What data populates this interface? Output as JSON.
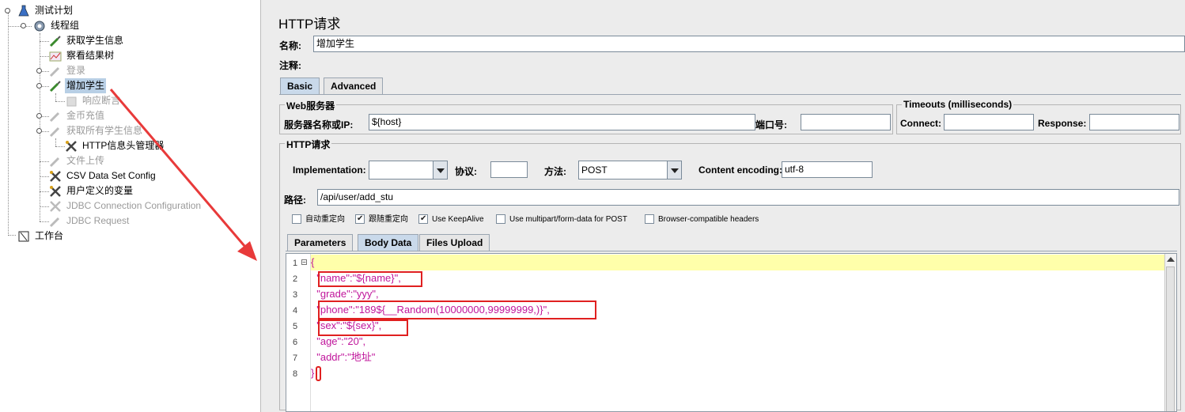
{
  "tree": {
    "root": "测试计划",
    "thread_group": "线程组",
    "items": [
      {
        "label": "获取学生信息",
        "disabled": false
      },
      {
        "label": "察看结果树",
        "disabled": false
      },
      {
        "label": "登录",
        "disabled": true
      },
      {
        "label": "增加学生",
        "disabled": false,
        "selected": true
      },
      {
        "label": "响应断言",
        "disabled": true
      },
      {
        "label": "金币充值",
        "disabled": true
      },
      {
        "label": "获取所有学生信息",
        "disabled": true
      },
      {
        "label": "HTTP信息头管理器",
        "disabled": false
      },
      {
        "label": "文件上传",
        "disabled": true
      },
      {
        "label": "CSV Data Set Config",
        "disabled": false
      },
      {
        "label": "用户定义的变量",
        "disabled": false
      },
      {
        "label": "JDBC Connection Configuration",
        "disabled": true
      },
      {
        "label": "JDBC Request",
        "disabled": true
      }
    ],
    "workbench": "工作台"
  },
  "panel": {
    "title": "HTTP请求",
    "name_label": "名称:",
    "name_value": "增加学生",
    "comment_label": "注释:",
    "tabs": [
      "Basic",
      "Advanced"
    ],
    "web_server_group": "Web服务器",
    "server_label": "服务器名称或IP:",
    "server_value": "${host}",
    "port_label": "端口号:",
    "port_value": "",
    "timeouts_group": "Timeouts (milliseconds)",
    "connect_label": "Connect:",
    "response_label": "Response:",
    "http_group": "HTTP请求",
    "impl_label": "Implementation:",
    "impl_value": "",
    "protocol_label": "协议:",
    "protocol_value": "",
    "method_label": "方法:",
    "method_value": "POST",
    "encoding_label": "Content encoding:",
    "encoding_value": "utf-8",
    "path_label": "路径:",
    "path_value": "/api/user/add_stu",
    "checkboxes": [
      {
        "label": "自动重定向",
        "checked": false
      },
      {
        "label": "跟随重定向",
        "checked": true
      },
      {
        "label": "Use KeepAlive",
        "checked": true
      },
      {
        "label": "Use multipart/form-data for POST",
        "checked": false
      },
      {
        "label": "Browser-compatible headers",
        "checked": false
      }
    ],
    "sub_tabs": [
      "Parameters",
      "Body Data",
      "Files Upload"
    ],
    "active_sub_tab": "Body Data"
  },
  "body_lines": [
    {
      "n": "1",
      "text": "{"
    },
    {
      "n": "2",
      "text": "  \"name\":\"${name}\","
    },
    {
      "n": "3",
      "text": "  \"grade\":\"yyy\","
    },
    {
      "n": "4",
      "text": "  \"phone\":\"189${__Random(10000000,99999999,)}\","
    },
    {
      "n": "5",
      "text": "  \"sex\":\"${sex}\","
    },
    {
      "n": "6",
      "text": "  \"age\":\"20\","
    },
    {
      "n": "7",
      "text": "  \"addr\":\"地址\""
    },
    {
      "n": "8",
      "text": "}"
    }
  ],
  "colors": {
    "annotation": "#e02020",
    "code_text": "#c0159b",
    "current_line": "#ffffaa",
    "selection": "#b8cfe5"
  }
}
